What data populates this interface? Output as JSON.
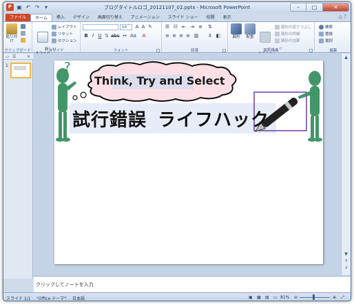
{
  "window": {
    "title": "ブログタイトルロゴ_20121107_02.pptx - Microsoft PowerPoint",
    "app_icon_letter": "P",
    "minimize": "–",
    "maximize": "□",
    "close": "✕"
  },
  "tabs": [
    "ファイル",
    "ホーム",
    "挿入",
    "デザイン",
    "画面切り替え",
    "アニメーション",
    "スライド ショー",
    "校閲",
    "表示"
  ],
  "ribbon": {
    "clipboard": {
      "paste": "貼り付け",
      "label": "クリップボード"
    },
    "slides": {
      "new_slide": "新しい\nスライド",
      "layout": "レイアウト",
      "reset": "リセット",
      "section": "セクション",
      "label": "スライド"
    },
    "font": {
      "font_name": "",
      "font_size": "10",
      "label": "フォント"
    },
    "paragraph": {
      "label": "段落"
    },
    "drawing": {
      "shape": "図形",
      "arrange": "配置",
      "quick_styles": "クイック\nスタイル",
      "fill": "図形の塗りつぶし",
      "outline": "図形の枠線",
      "effects": "図形の効果",
      "label": "図形描画"
    },
    "editing": {
      "find": "検索",
      "replace": "置換",
      "select": "選択",
      "label": "編集"
    }
  },
  "slide": {
    "cloud_text": "Think, Try and Select",
    "title_kanji": "試行錯誤",
    "title_kana": "ライフハック"
  },
  "thumbnail": {
    "number": "1"
  },
  "notes": {
    "placeholder": "クリックしてノートを入力"
  },
  "status": {
    "slide": "スライド 1/1",
    "theme": "\"Office テーマ\"",
    "language": "日本語",
    "zoom": "81%"
  },
  "colors": {
    "file_tab": "#d24726",
    "figure": "#2e8b57",
    "frame": "#6a3fa0"
  }
}
